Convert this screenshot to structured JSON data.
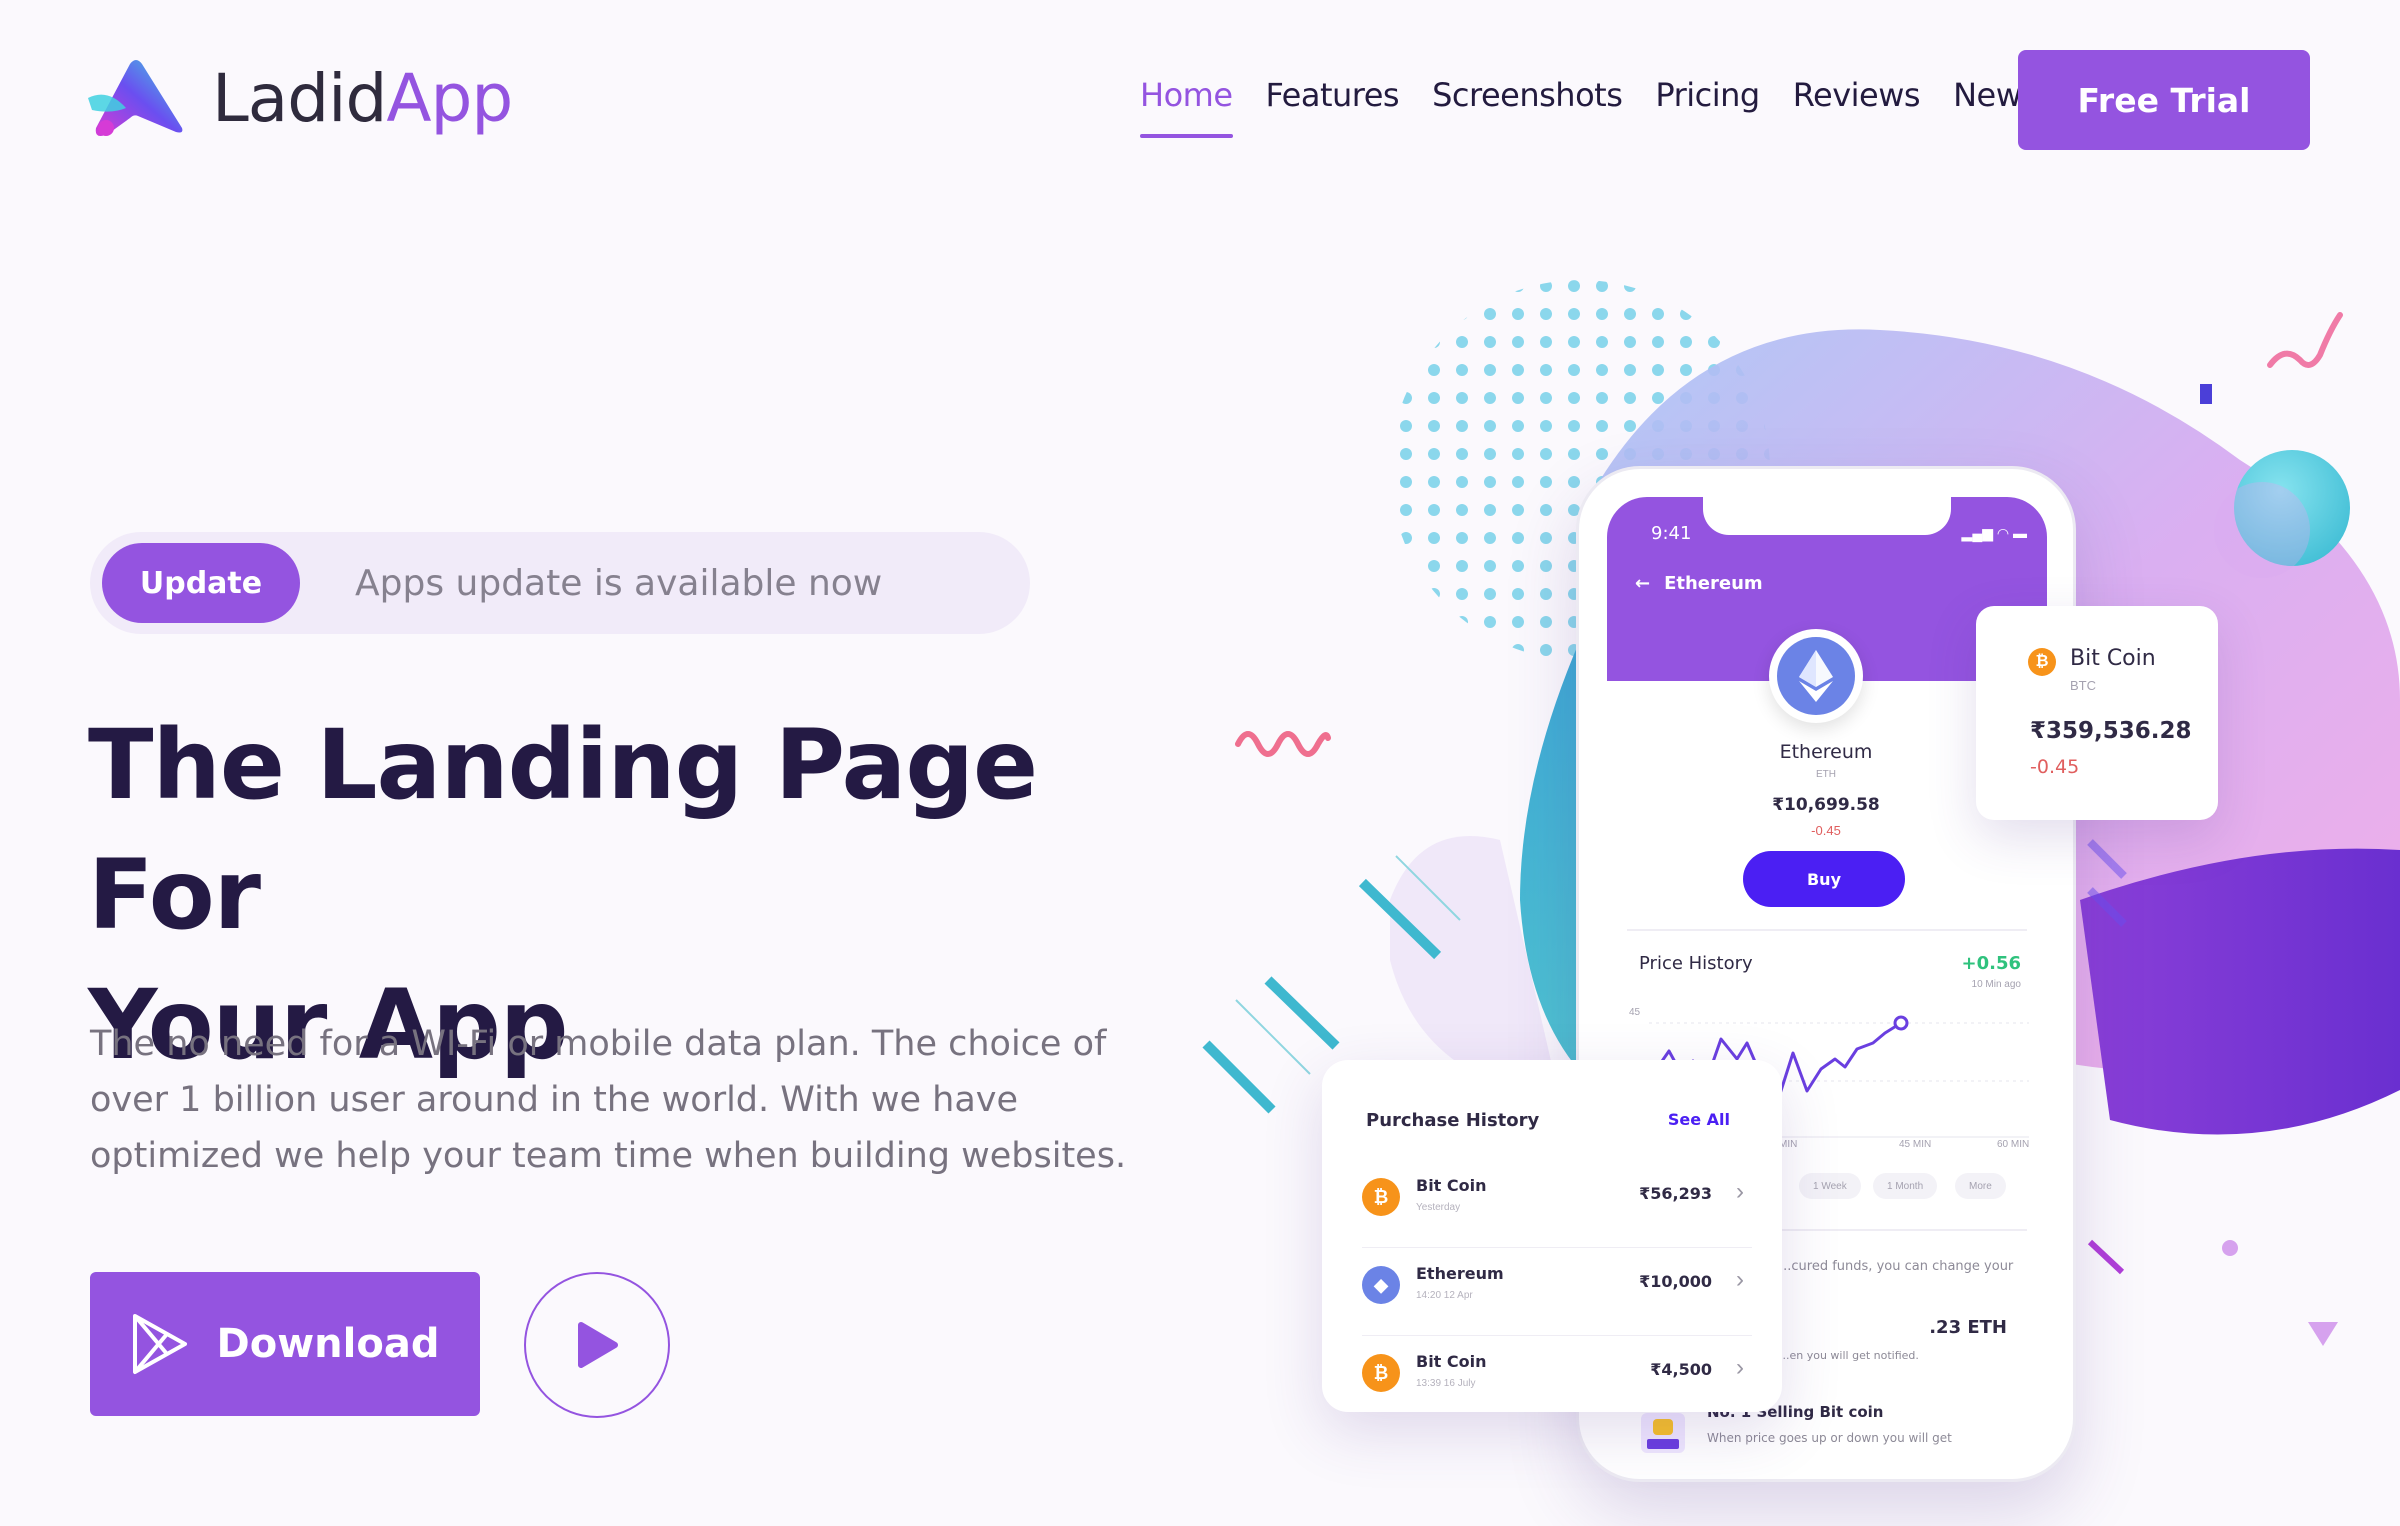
{
  "brand": {
    "name_part1": "Ladid",
    "name_part2": "App"
  },
  "nav": {
    "items": [
      {
        "label": "Home",
        "active": true
      },
      {
        "label": "Features"
      },
      {
        "label": "Screenshots"
      },
      {
        "label": "Pricing"
      },
      {
        "label": "Reviews"
      },
      {
        "label": "News"
      }
    ],
    "cta": "Free Trial"
  },
  "hero": {
    "badge": "Update",
    "badge_text": "Apps update is available now",
    "title_line1": "The Landing Page For",
    "title_line2": "Your App",
    "description": "The no need for a WI-Fi or mobile data plan. The choice of over 1 billion user around in the world. With we have optimized we help your team time when building websites.",
    "download_label": "Download"
  },
  "phone": {
    "time": "9:41",
    "back_label": "Ethereum",
    "coin_name": "Ethereum",
    "coin_symbol": "ETH",
    "coin_price": "₹10,699.58",
    "coin_change": "-0.45",
    "buy_label": "Buy",
    "price_history_title": "Price History",
    "price_history_value": "+0.56",
    "price_history_ago": "10 Min ago",
    "y_tick": "45",
    "x_ticks": [
      "MIN",
      "45 MIN",
      "60 MIN"
    ],
    "ranges": [
      "1 Week",
      "1 Month",
      "More"
    ],
    "note1": "...cured funds, you can change your",
    "eth_amount": ".23 ETH",
    "note2": "...en you will get notified.",
    "selling_title": "No. 1 Selling Bit coin",
    "selling_desc": "When price goes up or down you will get"
  },
  "btc_card": {
    "name": "Bit Coin",
    "symbol": "BTC",
    "price": "₹359,536.28",
    "change": "-0.45"
  },
  "purchase_history": {
    "title": "Purchase History",
    "see_all": "See All",
    "rows": [
      {
        "name": "Bit Coin",
        "date": "Yesterday",
        "amount": "₹56,293",
        "coin": "btc"
      },
      {
        "name": "Ethereum",
        "date": "14:20 12 Apr",
        "amount": "₹10,000",
        "coin": "eth"
      },
      {
        "name": "Bit Coin",
        "date": "13:39 16 July",
        "amount": "₹4,500",
        "coin": "btc"
      }
    ]
  },
  "colors": {
    "accent": "#9454e0",
    "heading": "#241a44",
    "buy_button": "#4b1ff3",
    "positive": "#2fc27d",
    "negative": "#e05e5e",
    "bitcoin": "#f7931a",
    "ethereum": "#6b83e6"
  },
  "icons": {
    "logo": "ladidapp-logo-icon",
    "download": "play-store-icon",
    "video": "play-icon",
    "back": "arrow-left-icon",
    "chevron": "chevron-right-icon"
  }
}
